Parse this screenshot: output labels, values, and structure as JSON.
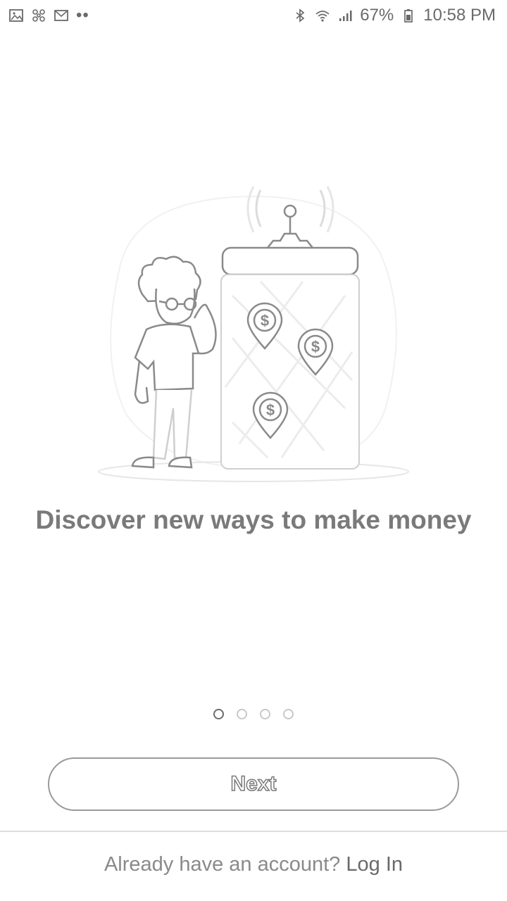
{
  "status_bar": {
    "left_icons": [
      "gallery-icon",
      "pinwheel-icon",
      "gmail-icon",
      "more-dots-icon"
    ],
    "more_dots": "••",
    "right_icons": [
      "bluetooth-icon",
      "wifi-icon",
      "signal-icon",
      "battery-icon"
    ],
    "battery": "67%",
    "time": "10:58 PM"
  },
  "onboarding": {
    "headline": "Discover new ways to make money",
    "pages": 4,
    "active_page": 1
  },
  "actions": {
    "next_label": "Next"
  },
  "footer": {
    "prompt": "Already have an account?",
    "login_label": "Log In"
  },
  "illustration": {
    "coin_symbol": "$"
  },
  "colors": {
    "text": "#7a7a7a",
    "border": "#9a9a9a",
    "background": "#ffffff"
  }
}
